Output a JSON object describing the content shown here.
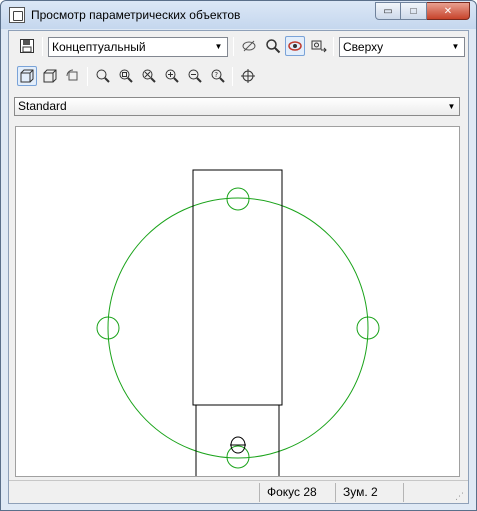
{
  "window": {
    "title": "Просмотр параметрических объектов",
    "minimize_glyph": "▭",
    "maximize_glyph": "□",
    "close_glyph": "✕"
  },
  "toolbar": {
    "visual_style": "Концептуальный",
    "view_direction": "Сверху",
    "named_style": "Standard"
  },
  "status": {
    "focus": "Фокус 28",
    "zoom": "Зум. 2"
  },
  "icons": [
    "save-icon",
    "hide-icon",
    "zoom-icon",
    "orbit-icon",
    "camera-icon",
    "view-3d-icon",
    "box-view-icon",
    "rotate-view-icon",
    "zoom-realtime-icon",
    "zoom-window-icon",
    "zoom-extents-icon",
    "zoom-in-icon",
    "zoom-out-icon",
    "zoom-help-icon",
    "pan-target-icon"
  ],
  "colors": {
    "geometry_lines": "#000000",
    "constraint_circles": "#1aa31a"
  }
}
